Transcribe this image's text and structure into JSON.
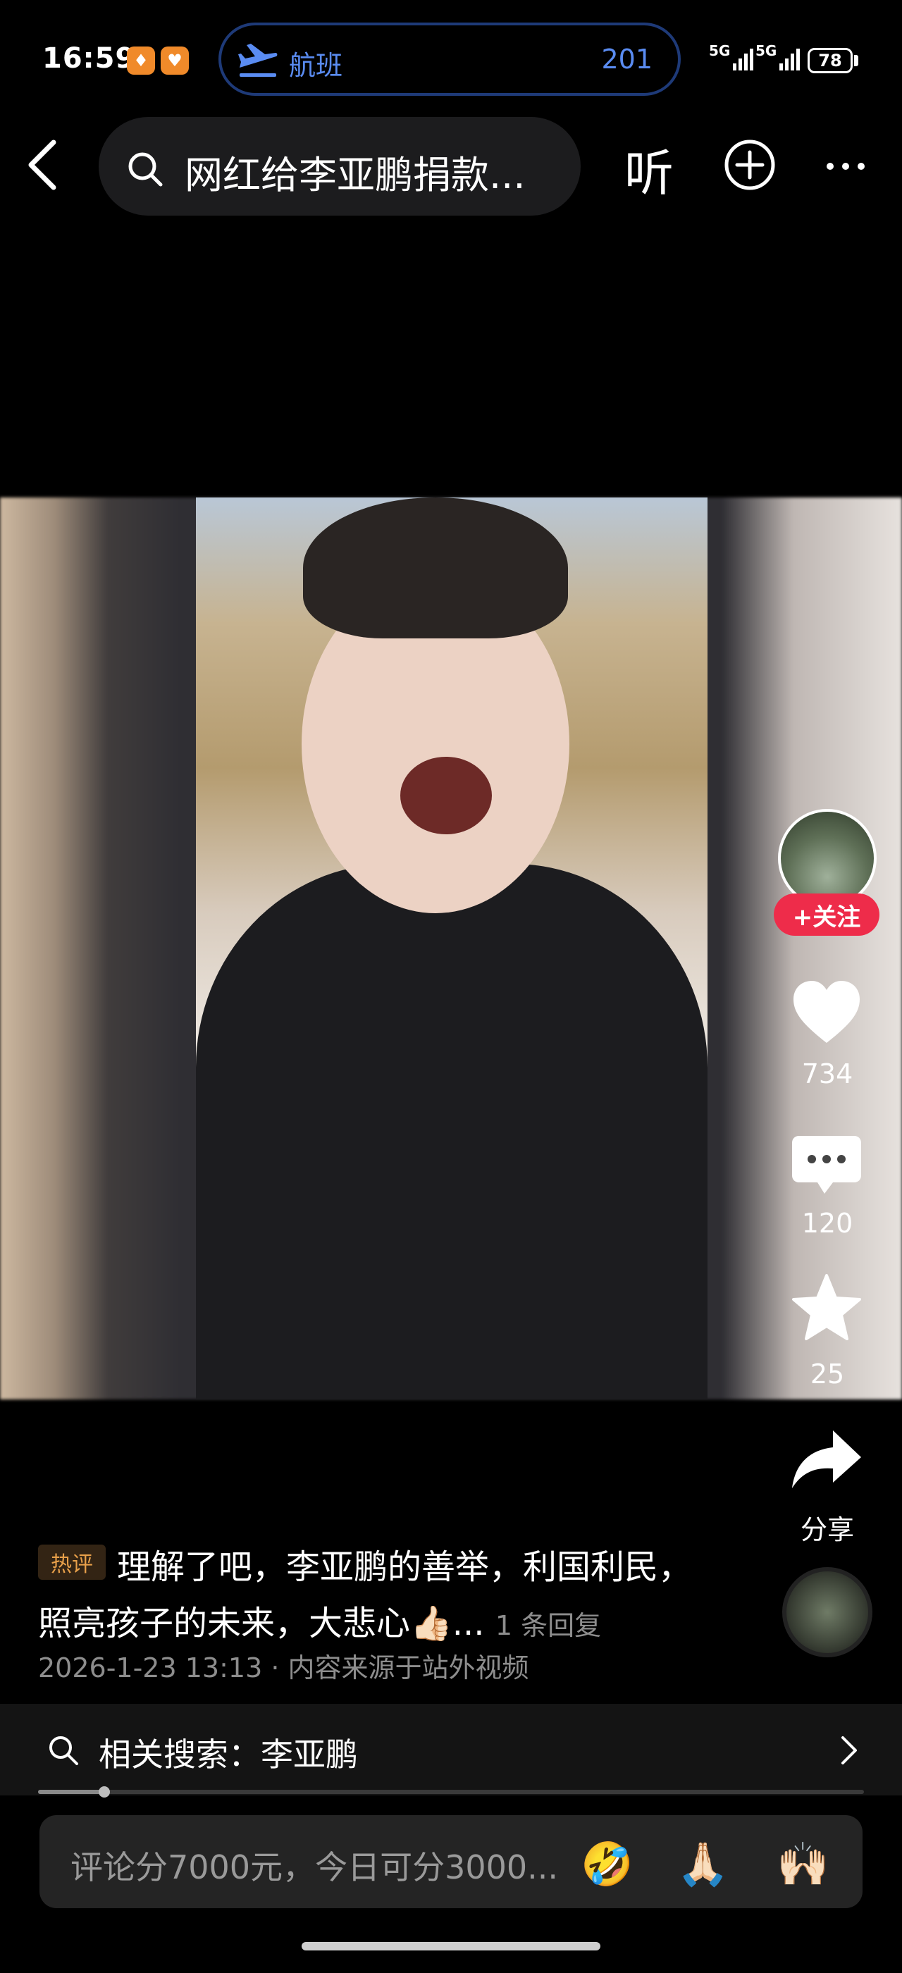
{
  "status_bar": {
    "time": "16:59",
    "flight_label": "航班",
    "flight_number": "201",
    "signal_1": "5G",
    "signal_2": "5G",
    "battery": "78"
  },
  "nav": {
    "search_query": "网红给李亚鹏捐款...",
    "listen_label": "听"
  },
  "actions": {
    "follow_label": "+关注",
    "likes": "734",
    "comments": "120",
    "favorites": "25",
    "share_label": "分享"
  },
  "hot_comment": {
    "tag": "热评",
    "line1": "理解了吧，李亚鹏的善举，利国利民，",
    "line2": "照亮孩子的未来，大悲心👍🏻...",
    "replies": "1 条回复",
    "meta": "2026-1-23 13:13 · 内容来源于站外视频"
  },
  "related_search": {
    "text": "相关搜索：李亚鹏",
    "progress": 0.08
  },
  "comment_input": {
    "placeholder": "评论分7000元，今日可分3000...",
    "emoji_1": "🤣",
    "emoji_2": "🙏🏻",
    "emoji_3": "🙌🏻"
  },
  "colors": {
    "accent_blue": "#5a8cf2",
    "follow_red": "#ee2c4a",
    "hot_tag": "#e8a04a"
  },
  "icons": [
    "airplane-icon",
    "back-chevron-icon",
    "search-icon",
    "add-circle-icon",
    "more-dots-icon",
    "heart-icon",
    "comment-icon",
    "star-icon",
    "share-arrow-icon",
    "chevron-right-icon"
  ]
}
